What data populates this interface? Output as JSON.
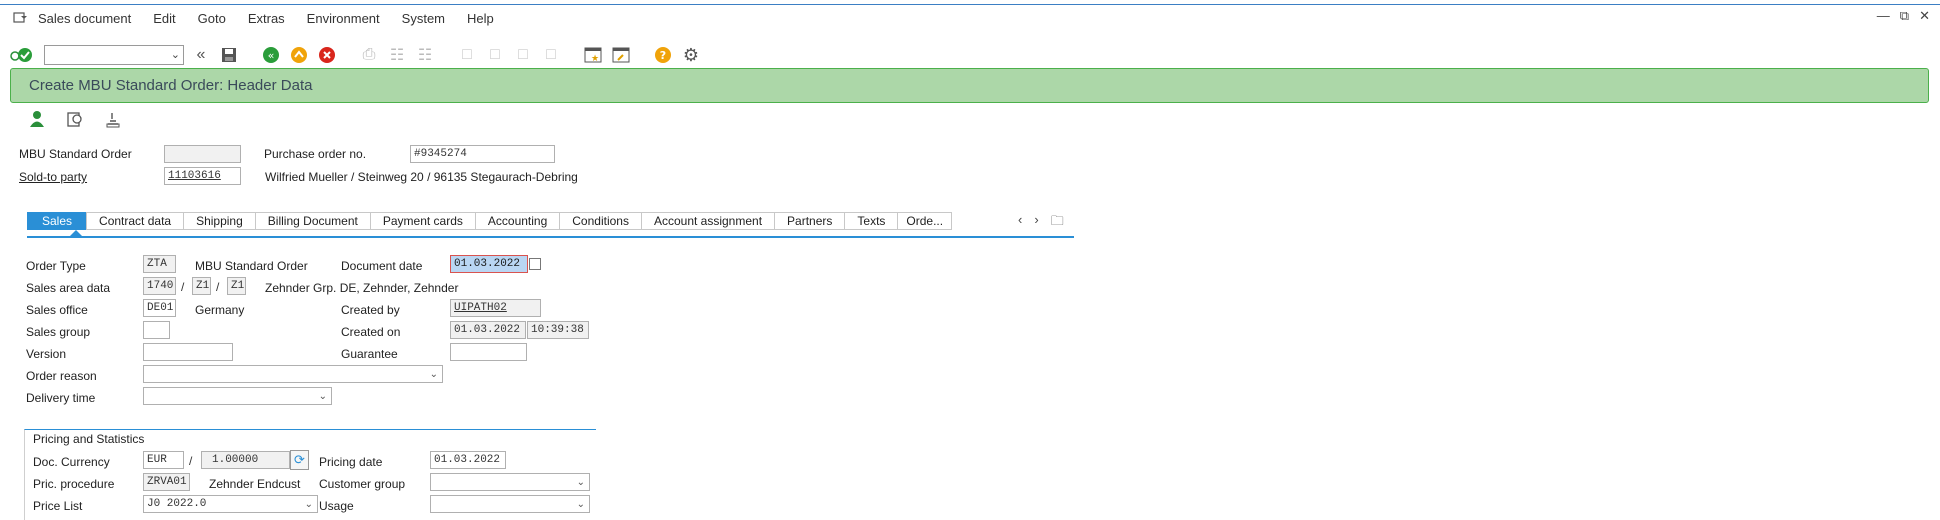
{
  "menu": {
    "items": [
      "Sales document",
      "Edit",
      "Goto",
      "Extras",
      "Environment",
      "System",
      "Help"
    ]
  },
  "title": "Create MBU Standard Order: Header Data",
  "header": {
    "order_type_label": "MBU Standard Order",
    "order_type_value": "",
    "po_label": "Purchase order no.",
    "po_value": "#9345274",
    "soldto_label": "Sold-to party",
    "soldto_value": "11103616",
    "soldto_address": "Wilfried Mueller / Steinweg 20 / 96135 Stegaurach-Debring"
  },
  "tabs": [
    "Sales",
    "Contract data",
    "Shipping",
    "Billing Document",
    "Payment cards",
    "Accounting",
    "Conditions",
    "Account assignment",
    "Partners",
    "Texts",
    "Orde..."
  ],
  "sales": {
    "order_type_label": "Order Type",
    "order_type_code": "ZTA",
    "order_type_desc": "MBU Standard Order",
    "doc_date_label": "Document date",
    "doc_date_value": "01.03.2022",
    "sales_area_label": "Sales area data",
    "sales_org": "1740",
    "dist_channel": "Z1",
    "division": "Z1",
    "sales_area_desc": "Zehnder Grp. DE, Zehnder, Zehnder",
    "sales_office_label": "Sales office",
    "sales_office_code": "DE01",
    "sales_office_desc": "Germany",
    "created_by_label": "Created by",
    "created_by_value": "UIPATH02",
    "sales_group_label": "Sales group",
    "created_on_label": "Created on",
    "created_on_date": "01.03.2022",
    "created_on_time": "10:39:38",
    "version_label": "Version",
    "guarantee_label": "Guarantee",
    "order_reason_label": "Order reason",
    "delivery_time_label": "Delivery time"
  },
  "pricing": {
    "group_title": "Pricing and Statistics",
    "doc_currency_label": "Doc. Currency",
    "currency": "EUR",
    "exchange_rate": "1.00000",
    "pricing_date_label": "Pricing date",
    "pricing_date": "01.03.2022",
    "pric_procedure_label": "Pric. procedure",
    "pric_procedure_code": "ZRVA01",
    "pric_procedure_desc": "Zehnder Endcust",
    "customer_group_label": "Customer group",
    "price_list_label": "Price List",
    "price_list_value": "J0 2022.0",
    "usage_label": "Usage"
  },
  "colors": {
    "title_bg": "#acd7a8",
    "title_border": "#4bb04b",
    "tab_active": "#2a8fd6"
  }
}
